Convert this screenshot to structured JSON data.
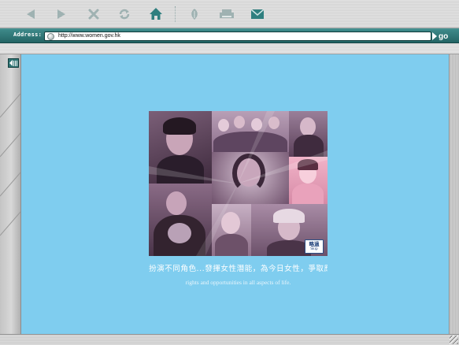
{
  "toolbar": {
    "buttons": [
      "back-icon",
      "forward-icon",
      "stop-icon",
      "refresh-icon",
      "home-icon",
      "favorites-icon",
      "print-icon",
      "mail-icon"
    ]
  },
  "address_bar": {
    "label": "Address:",
    "url": "http://www.women.gov.hk",
    "go_label": "go"
  },
  "page": {
    "tagline_cn": "扮演不同角色...發揮女性潛能，為今日女性，爭取應",
    "tagline_en": "rights and opportunities in all aspects of life.",
    "skip_cn": "略過",
    "skip_en": "Skip"
  },
  "colors": {
    "content_background": "#7fcdef",
    "address_bar": "#2e7676",
    "icon_teal": "#3a8a8a"
  }
}
